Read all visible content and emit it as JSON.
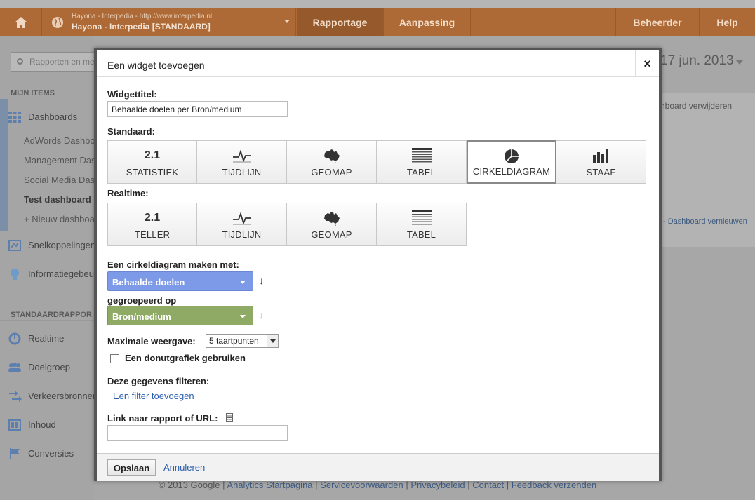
{
  "topnav": {
    "account_line1": "Hayona - Interpedia - http://www.interpedia.nl",
    "account_line2": "Hayona - Interpedia [STANDAARD]",
    "tabs": [
      {
        "label": "Rapportage"
      },
      {
        "label": "Aanpassing"
      },
      {
        "label": "Beheerder"
      },
      {
        "label": "Help"
      }
    ],
    "accent_color": "#ad6a36"
  },
  "sidebar": {
    "search_placeholder": "Rapporten en me",
    "my_items_heading": "MIJN ITEMS",
    "dashboards_label": "Dashboards",
    "dashboards": [
      {
        "label": "AdWords Dashbo"
      },
      {
        "label": "Management Das"
      },
      {
        "label": "Social Media Das"
      },
      {
        "label": "Test dashboard"
      },
      {
        "label": "+ Nieuw dashboa"
      }
    ],
    "shortcuts_label": "Snelkoppelingen",
    "intel_label": "Informatiegebeur",
    "standard_heading": "STANDAARDRAPPOR",
    "reports": [
      {
        "label": "Realtime",
        "icon": "realtime-icon"
      },
      {
        "label": "Doelgroep",
        "icon": "audience-icon"
      },
      {
        "label": "Verkeersbronnen",
        "icon": "traffic-icon"
      },
      {
        "label": "Inhoud",
        "icon": "content-icon"
      },
      {
        "label": "Conversies",
        "icon": "flag-icon"
      }
    ]
  },
  "right": {
    "date": "17 jun. 2013",
    "remove_dashboard": "hboard verwijderen",
    "renew_dashboard": "- Dashboard vernieuwen"
  },
  "dialog": {
    "title": "Een widget toevoegen",
    "close_symbol": "×",
    "widget_title_label": "Widgettitel:",
    "widget_title_value": "Behaalde doelen per Bron/medium",
    "standard_label": "Standaard:",
    "standard_types": [
      {
        "label": "STATISTIEK",
        "icon_text": "2.1",
        "icon": "number-icon",
        "selected": false
      },
      {
        "label": "TIJDLIJN",
        "icon": "timeline-icon",
        "selected": false
      },
      {
        "label": "GEOMAP",
        "icon": "geomap-icon",
        "selected": false
      },
      {
        "label": "TABEL",
        "icon": "table-icon",
        "selected": false
      },
      {
        "label": "CIRKELDIAGRAM",
        "icon": "pie-chart-icon",
        "selected": true
      },
      {
        "label": "STAAF",
        "icon": "bar-chart-icon",
        "selected": false
      }
    ],
    "realtime_label": "Realtime:",
    "realtime_types": [
      {
        "label": "TELLER",
        "icon_text": "2.1",
        "icon": "number-icon"
      },
      {
        "label": "TIJDLIJN",
        "icon": "timeline-icon"
      },
      {
        "label": "GEOMAP",
        "icon": "geomap-icon"
      },
      {
        "label": "TABEL",
        "icon": "table-icon"
      }
    ],
    "pie_with_label": "Een cirkeldiagram maken met:",
    "metric_value": "Behaalde doelen",
    "metric_color": "#7d9ae8",
    "grouped_label": "gegroepeerd op",
    "dimension_value": "Bron/medium",
    "dimension_color": "#8eaa64",
    "max_display_label": "Maximale weergave:",
    "max_display_value": "5 taartpunten",
    "donut_label": "Een donutgrafiek gebruiken",
    "donut_checked": false,
    "filter_label": "Deze gegevens filteren:",
    "add_filter": "Een filter toevoegen",
    "link_label": "Link naar rapport of URL:",
    "link_value": "",
    "save_label": "Opslaan",
    "cancel_label": "Annuleren"
  },
  "footer": {
    "copyright": "© 2013 Google",
    "links": [
      "Analytics Startpagina",
      "Servicevoorwaarden",
      "Privacybeleid",
      "Contact",
      "Feedback verzenden"
    ],
    "separator": "|"
  }
}
